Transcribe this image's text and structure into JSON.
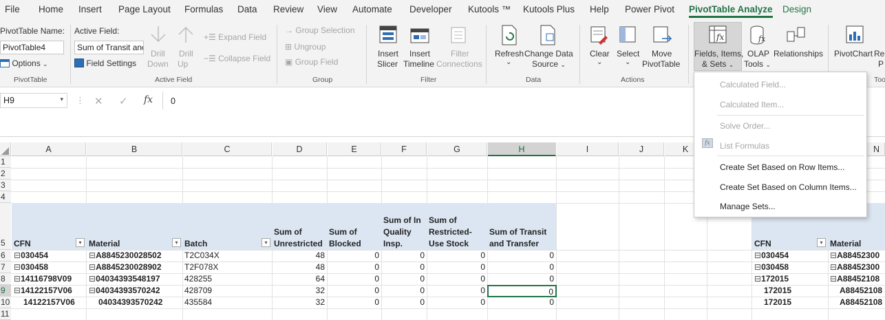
{
  "menu": {
    "tabs": [
      "File",
      "Home",
      "Insert",
      "Page Layout",
      "Formulas",
      "Data",
      "Review",
      "View",
      "Automate",
      "Developer",
      "Kutools ™",
      "Kutools Plus",
      "Help",
      "Power Pivot",
      "PivotTable Analyze",
      "Design"
    ],
    "active": "PivotTable Analyze"
  },
  "ribbon": {
    "pivottable": {
      "name_label": "PivotTable Name:",
      "name_value": "PivotTable4",
      "options": "Options",
      "group": "PivotTable"
    },
    "active_field": {
      "label": "Active Field:",
      "value": "Sum of Transit anc",
      "field_settings": "Field Settings",
      "drill_down_1": "Drill",
      "drill_down_2": "Down",
      "drill_up_1": "Drill",
      "drill_up_2": "Up",
      "expand": "Expand Field",
      "collapse": "Collapse Field",
      "group": "Active Field"
    },
    "group_grp": {
      "group_selection": "Group Selection",
      "ungroup": "Ungroup",
      "group_field": "Group Field",
      "group": "Group"
    },
    "filter": {
      "insert_slicer_1": "Insert",
      "insert_slicer_2": "Slicer",
      "insert_timeline_1": "Insert",
      "insert_timeline_2": "Timeline",
      "filter_conn_1": "Filter",
      "filter_conn_2": "Connections",
      "group": "Filter"
    },
    "data": {
      "refresh": "Refresh",
      "change_source_1": "Change Data",
      "change_source_2": "Source",
      "group": "Data"
    },
    "actions": {
      "clear": "Clear",
      "select": "Select",
      "move_1": "Move",
      "move_2": "PivotTable",
      "group": "Actions"
    },
    "calculations": {
      "fields_items_1": "Fields, Items,",
      "fields_items_2": "& Sets",
      "olap_1": "OLAP",
      "olap_2": "Tools",
      "relationships": "Relationships",
      "group": "Calculations"
    },
    "tools": {
      "pivotchart": "PivotChart",
      "rec": "Re",
      "rec2": "P",
      "group": "Too"
    }
  },
  "formula_bar": {
    "name_box": "H9",
    "fx": "fx",
    "value": "0"
  },
  "columns": [
    "A",
    "B",
    "C",
    "D",
    "E",
    "F",
    "G",
    "H",
    "I",
    "J",
    "K",
    "N"
  ],
  "rows": [
    "1",
    "2",
    "3",
    "4",
    "5",
    "6",
    "7",
    "8",
    "9",
    "10",
    "11"
  ],
  "pivot_headers": {
    "cfn": "CFN",
    "material": "Material",
    "batch": "Batch",
    "unrestricted_1": "Sum of",
    "unrestricted_2": "Unrestricted",
    "blocked_1": "Sum of",
    "blocked_2": "Blocked",
    "quality_1": "Sum of In",
    "quality_2": "Quality",
    "quality_3": "Insp.",
    "restricted_1": "Sum of",
    "restricted_2": "Restricted-",
    "restricted_3": "Use Stock",
    "transit_1": "Sum of Transit",
    "transit_2": "and Transfer"
  },
  "pivot_rows": [
    {
      "cfn": "030454",
      "material": "A8845230028502",
      "batch": "T2C034X",
      "unr": "48",
      "blk": "0",
      "qi": "0",
      "rs": "0",
      "tr": "0"
    },
    {
      "cfn": "030458",
      "material": "A8845230028902",
      "batch": "T2F078X",
      "unr": "48",
      "blk": "0",
      "qi": "0",
      "rs": "0",
      "tr": "0"
    },
    {
      "cfn": "14116798V09",
      "material": "04034393548197",
      "batch": "428255",
      "unr": "64",
      "blk": "0",
      "qi": "0",
      "rs": "0",
      "tr": "0"
    },
    {
      "cfn": "14122157V06",
      "material": "04034393570242",
      "batch": "428709",
      "unr": "32",
      "blk": "0",
      "qi": "0",
      "rs": "0",
      "tr": "0"
    },
    {
      "cfn": "14122157V06",
      "material": "04034393570242",
      "batch": "435584",
      "unr": "32",
      "blk": "0",
      "qi": "0",
      "rs": "0",
      "tr": "0"
    }
  ],
  "pivot2": {
    "cfn": "CFN",
    "material": "Material",
    "rows": [
      {
        "cfn": "030454",
        "material": "A88452300"
      },
      {
        "cfn": "030458",
        "material": "A88452300"
      },
      {
        "cfn": "172015",
        "material": "A88452108"
      },
      {
        "cfn": "172015",
        "material": "A88452108"
      },
      {
        "cfn": "172015",
        "material": "A88452108"
      }
    ]
  },
  "dropdown": {
    "calc_field": "Calculated Field...",
    "calc_item": "Calculated Item...",
    "solve_order": "Solve Order...",
    "list_formulas": "List Formulas",
    "row_set": "Create Set Based on Row Items...",
    "col_set": "Create Set Based on Column Items...",
    "manage_sets": "Manage Sets..."
  },
  "colors": {
    "accent": "#217346",
    "pivot_header": "#dce6f2",
    "ribbon_bg": "#f3f3f3"
  }
}
